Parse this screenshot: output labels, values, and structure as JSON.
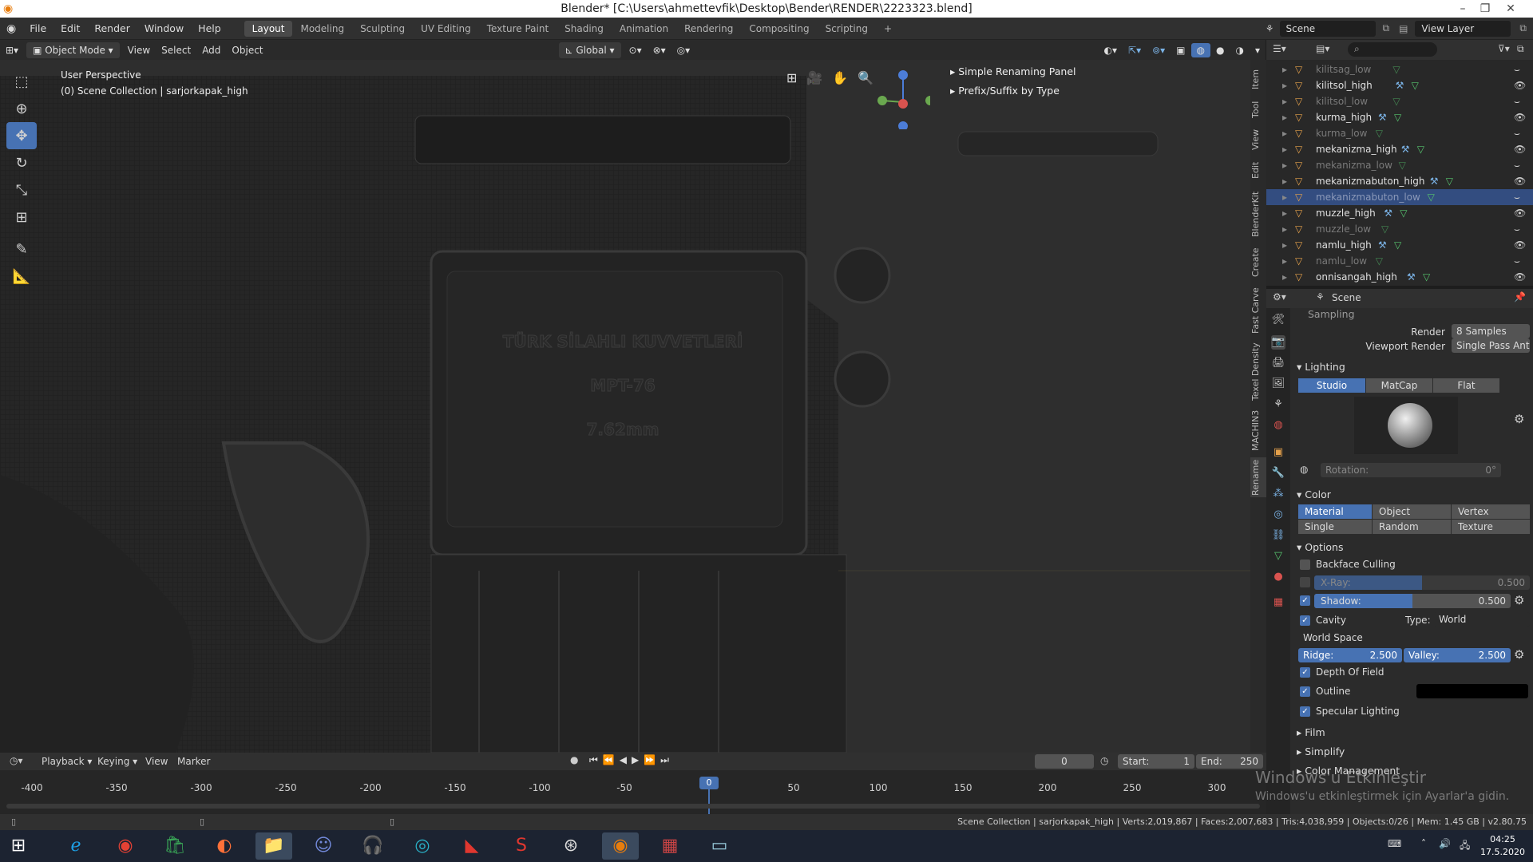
{
  "window": {
    "title": "Blender* [C:\\Users\\ahmettevfik\\Desktop\\Bender\\RENDER\\2223323.blend]"
  },
  "menus": [
    "File",
    "Edit",
    "Render",
    "Window",
    "Help"
  ],
  "workspaces": [
    "Layout",
    "Modeling",
    "Sculpting",
    "UV Editing",
    "Texture Paint",
    "Shading",
    "Animation",
    "Rendering",
    "Compositing",
    "Scripting"
  ],
  "active_workspace": "Layout",
  "scene": {
    "name": "Scene",
    "view_layer": "View Layer"
  },
  "viewport_header": {
    "mode": "Object Mode",
    "menus": [
      "View",
      "Select",
      "Add",
      "Object"
    ],
    "orientation": "Global"
  },
  "viewport": {
    "perspective": "User Perspective",
    "collection": "(0) Scene Collection | sarjorkapak_high",
    "engraving": [
      "TÜRK SİLAHLI KUVVETLERİ",
      "MPT-76",
      "7.62mm"
    ]
  },
  "npanel": {
    "items": [
      "Simple Renaming Panel",
      "Prefix/Suffix by Type"
    ],
    "tabs": [
      "Item",
      "Tool",
      "View",
      "Edit",
      "BlenderKit",
      "Create",
      "Fast Carve",
      "Texel Density",
      "MACHIN3",
      "Rename"
    ]
  },
  "outliner": {
    "rows": [
      {
        "name": "kilitsag_low",
        "type": "low"
      },
      {
        "name": "kilitsol_high",
        "type": "high"
      },
      {
        "name": "kilitsol_low",
        "type": "low"
      },
      {
        "name": "kurma_high",
        "type": "high"
      },
      {
        "name": "kurma_low",
        "type": "low"
      },
      {
        "name": "mekanizma_high",
        "type": "high"
      },
      {
        "name": "mekanizma_low",
        "type": "low"
      },
      {
        "name": "mekanizmabuton_high",
        "type": "high"
      },
      {
        "name": "mekanizmabuton_low",
        "type": "selected"
      },
      {
        "name": "muzzle_high",
        "type": "high"
      },
      {
        "name": "muzzle_low",
        "type": "low"
      },
      {
        "name": "namlu_high",
        "type": "high"
      },
      {
        "name": "namlu_low",
        "type": "low"
      },
      {
        "name": "onnisangah_high",
        "type": "high"
      }
    ]
  },
  "properties": {
    "context": "Scene",
    "sampling_header": "Sampling",
    "render_label": "Render",
    "render_value": "8 Samples",
    "viewport_render_label": "Viewport Render",
    "viewport_render_value": "Single Pass Anti-Aliasing",
    "lighting": {
      "header": "Lighting",
      "options": [
        "Studio",
        "MatCap",
        "Flat"
      ],
      "active": "Studio",
      "rotation_label": "Rotation:",
      "rotation_value": "0°"
    },
    "color": {
      "header": "Color",
      "options": [
        "Material",
        "Object",
        "Vertex",
        "Single",
        "Random",
        "Texture"
      ],
      "active": "Material"
    },
    "options": {
      "header": "Options",
      "backface_culling": "Backface Culling",
      "xray_label": "X-Ray:",
      "xray_value": "0.500",
      "shadow_label": "Shadow:",
      "shadow_value": "0.500",
      "cavity": "Cavity",
      "type_label": "Type:",
      "type_value": "World",
      "world_space": "World Space",
      "ridge_label": "Ridge:",
      "ridge_value": "2.500",
      "valley_label": "Valley:",
      "valley_value": "2.500",
      "dof": "Depth Of Field",
      "outline": "Outline",
      "specular": "Specular Lighting"
    },
    "collapsed": [
      "Film",
      "Simplify",
      "Color Management"
    ]
  },
  "timeline": {
    "menus": [
      "Playback",
      "Keying",
      "View",
      "Marker"
    ],
    "current_frame": "0",
    "start_label": "Start:",
    "start_value": "1",
    "end_label": "End:",
    "end_value": "250",
    "ticks": [
      "-400",
      "-350",
      "-300",
      "-250",
      "-200",
      "-150",
      "-100",
      "-50",
      "0",
      "50",
      "100",
      "150",
      "200",
      "250",
      "300"
    ]
  },
  "status": {
    "text": "Scene Collection | sarjorkapak_high | Verts:2,019,867 | Faces:2,007,683 | Tris:4,038,959 | Objects:0/26 | Mem: 1.45 GB | v2.80.75"
  },
  "watermark": {
    "line1": "Windows'u Etkinleştir",
    "line2": "Windows'u etkinleştirmek için Ayarlar'a gidin."
  },
  "taskbar": {
    "time": "04:25",
    "date": "17.5.2020"
  },
  "colors": {
    "accent": "#4772b3",
    "header": "#303030",
    "panel": "#2b2b2b",
    "viewport": "#2d2d2d"
  }
}
